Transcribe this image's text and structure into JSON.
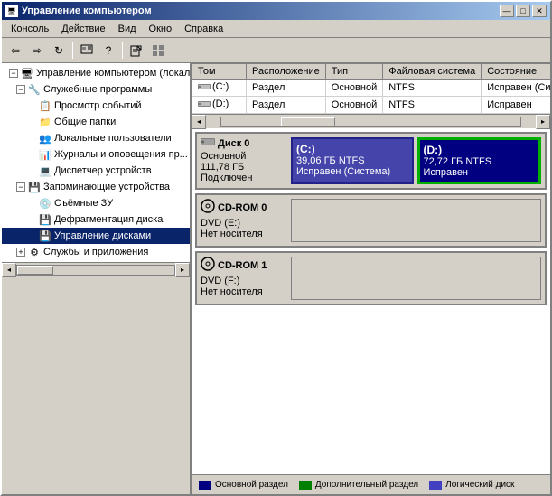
{
  "window": {
    "title": "Управление компьютером",
    "title_icon": "🖥"
  },
  "title_buttons": {
    "minimize": "—",
    "maximize": "□",
    "close": "✕"
  },
  "menu": {
    "items": [
      {
        "id": "console",
        "label": "Консоль"
      },
      {
        "id": "action",
        "label": "Действие"
      },
      {
        "id": "view",
        "label": "Вид"
      },
      {
        "id": "window",
        "label": "Окно"
      },
      {
        "id": "help",
        "label": "Справка"
      }
    ]
  },
  "toolbar": {
    "buttons": [
      "←",
      "→",
      "↻",
      "⊞",
      "?",
      "⬛",
      "📁",
      "⬛"
    ]
  },
  "tree": {
    "items": [
      {
        "id": "root",
        "label": "Управление компьютером (локал...",
        "level": 0,
        "expanded": true,
        "icon": "🖥"
      },
      {
        "id": "system_tools",
        "label": "Служебные программы",
        "level": 1,
        "expanded": true,
        "icon": "🔧"
      },
      {
        "id": "event_viewer",
        "label": "Просмотр событий",
        "level": 2,
        "icon": "📋"
      },
      {
        "id": "shared_folders",
        "label": "Общие папки",
        "level": 2,
        "icon": "📁"
      },
      {
        "id": "local_users",
        "label": "Локальные пользователи",
        "level": 2,
        "icon": "👥"
      },
      {
        "id": "logs",
        "label": "Журналы и оповещения пр...",
        "level": 2,
        "icon": "📊"
      },
      {
        "id": "device_manager",
        "label": "Диспетчер устройств",
        "level": 2,
        "icon": "💻"
      },
      {
        "id": "storage",
        "label": "Запоминающие устройства",
        "level": 1,
        "expanded": true,
        "icon": "💾"
      },
      {
        "id": "removable",
        "label": "Съёмные ЗУ",
        "level": 2,
        "icon": "💿"
      },
      {
        "id": "defrag",
        "label": "Дефрагментация диска",
        "level": 2,
        "icon": "💾"
      },
      {
        "id": "disk_mgmt",
        "label": "Управление дисками",
        "level": 2,
        "icon": "💾",
        "selected": true
      },
      {
        "id": "services",
        "label": "Службы и приложения",
        "level": 1,
        "icon": "⚙"
      }
    ]
  },
  "table": {
    "headers": [
      "Том",
      "Расположение",
      "Тип",
      "Файловая система",
      "Состояние"
    ],
    "rows": [
      {
        "volume": "(C:)",
        "location": "Раздел",
        "type": "Основной",
        "fs": "NTFS",
        "status": "Исправен (Систе..."
      },
      {
        "volume": "(D:)",
        "location": "Раздел",
        "type": "Основной",
        "fs": "NTFS",
        "status": "Исправен"
      }
    ]
  },
  "disks": [
    {
      "id": "disk0",
      "label": "Диск 0",
      "type": "Основной",
      "size": "111,78 ГБ",
      "status": "Подключен",
      "partitions": [
        {
          "name": "(C:)",
          "size": "39,06 ГБ NTFS",
          "status": "Исправен (Система)",
          "color": "primary",
          "selected": false
        },
        {
          "name": "(D:)",
          "size": "72,72 ГБ NTFS",
          "status": "Исправен",
          "color": "dark-blue",
          "selected": true
        }
      ]
    },
    {
      "id": "cdrom0",
      "label": "CD-ROM 0",
      "type": "DVD (E:)",
      "size": "",
      "status": "Нет носителя",
      "partitions": []
    },
    {
      "id": "cdrom1",
      "label": "CD-ROM 1",
      "type": "DVD (F:)",
      "size": "",
      "status": "Нет носителя",
      "partitions": []
    }
  ],
  "legend": {
    "items": [
      {
        "id": "primary",
        "label": "Основной раздел",
        "color": "primary"
      },
      {
        "id": "extended",
        "label": "Дополнительный раздел",
        "color": "extended"
      },
      {
        "id": "logical",
        "label": "Логический диск",
        "color": "logical"
      }
    ]
  }
}
